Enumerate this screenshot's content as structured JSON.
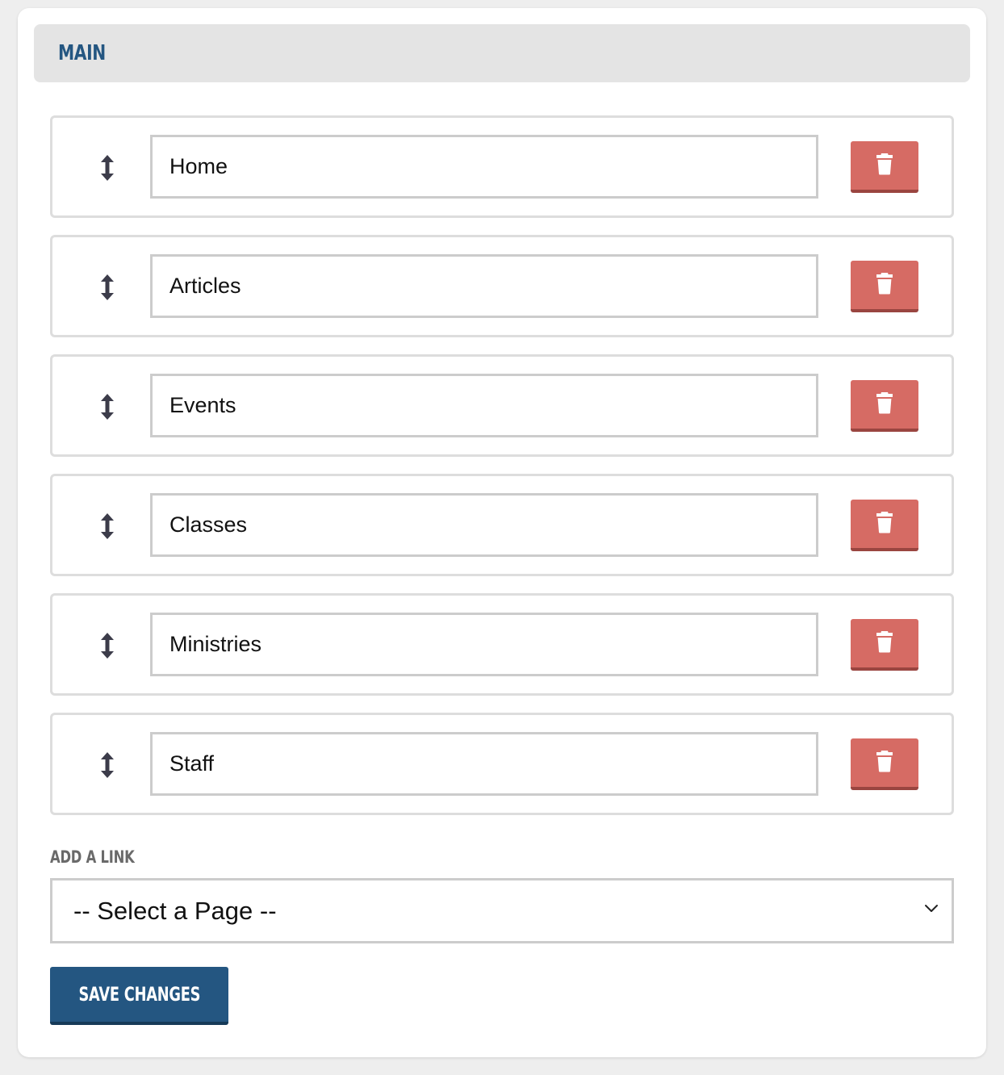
{
  "section": {
    "title": "MAIN"
  },
  "links": [
    {
      "label": "Home"
    },
    {
      "label": "Articles"
    },
    {
      "label": "Events"
    },
    {
      "label": "Classes"
    },
    {
      "label": "Ministries"
    },
    {
      "label": "Staff"
    }
  ],
  "icons": {
    "drag": "drag-vertical-icon",
    "delete": "trash-icon",
    "dropdown": "chevron-down-icon"
  },
  "add_link": {
    "label": "ADD A LINK",
    "select_value": "-- Select a Page --"
  },
  "actions": {
    "save_label": "SAVE CHANGES"
  },
  "colors": {
    "header_text": "#245681",
    "header_bg": "#e4e4e4",
    "delete_button": "#d66b64",
    "save_button": "#245681"
  }
}
